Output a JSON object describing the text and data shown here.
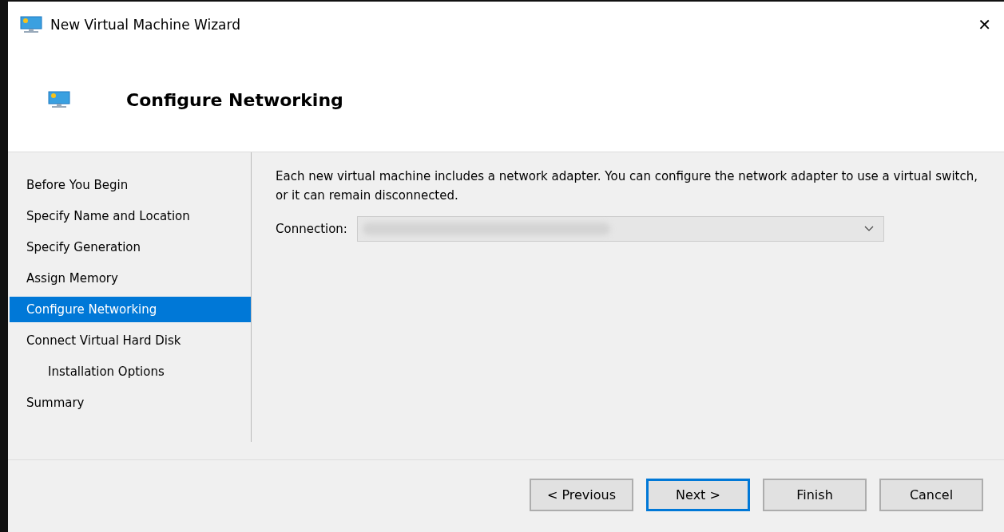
{
  "window": {
    "title": "New Virtual Machine Wizard",
    "close": "✕"
  },
  "header": {
    "title": "Configure Networking"
  },
  "steps": [
    {
      "label": "Before You Begin",
      "selected": false
    },
    {
      "label": "Specify Name and Location",
      "selected": false
    },
    {
      "label": "Specify Generation",
      "selected": false
    },
    {
      "label": "Assign Memory",
      "selected": false
    },
    {
      "label": "Configure Networking",
      "selected": true
    },
    {
      "label": "Connect Virtual Hard Disk",
      "selected": false,
      "children": [
        {
          "label": "Installation Options",
          "selected": false
        }
      ]
    },
    {
      "label": "Summary",
      "selected": false
    }
  ],
  "description": "Each new virtual machine includes a network adapter. You can configure the network adapter to use a virtual switch, or it can remain disconnected.",
  "connection": {
    "label": "Connection:",
    "disabled": true
  },
  "buttons": [
    {
      "label": "< Previous",
      "focused": false
    },
    {
      "label": "Next >",
      "focused": true
    },
    {
      "label": "Finish",
      "focused": false
    },
    {
      "label": "Cancel",
      "focused": false
    }
  ]
}
